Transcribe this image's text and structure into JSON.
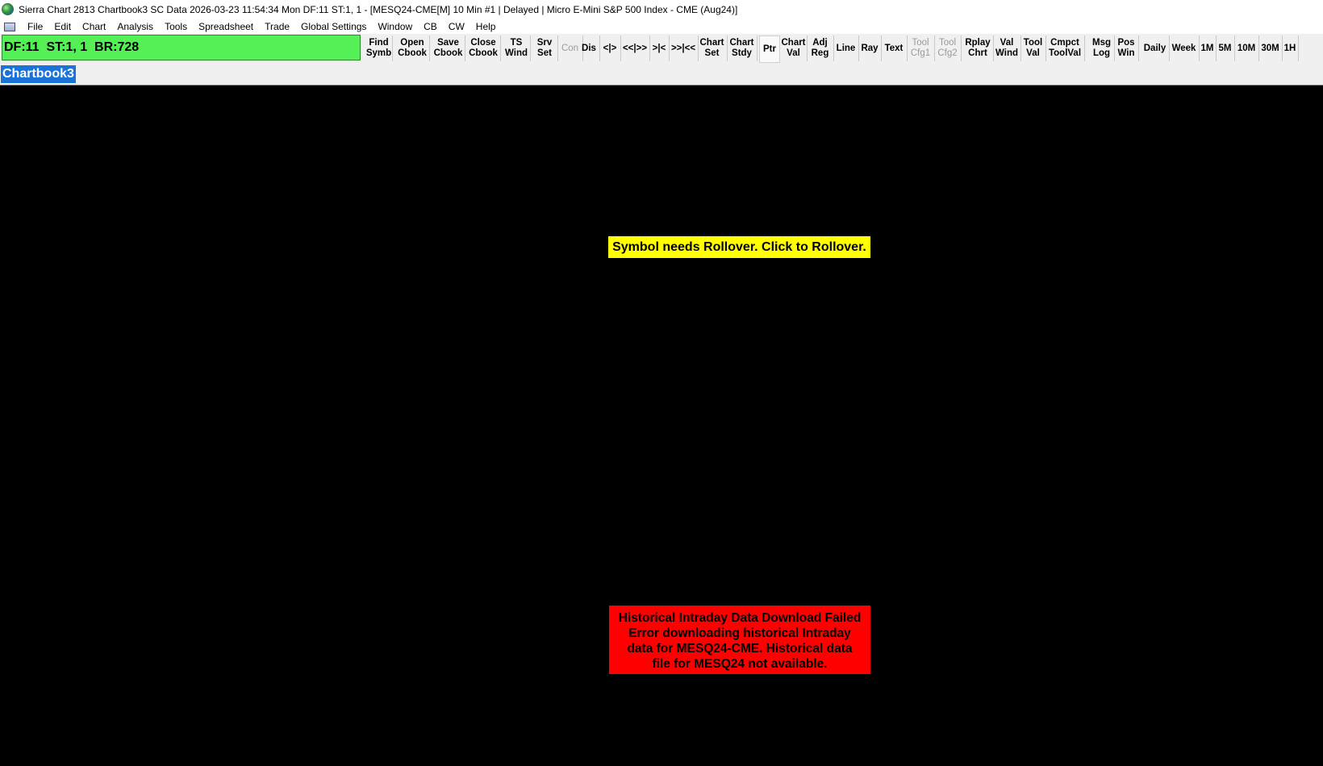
{
  "titlebar": {
    "icon": "sierra-chart-globe-icon",
    "text": "Sierra Chart 2813 Chartbook3 SC Data 2026-03-23  11:54:34 Mon DF:11  ST:1, 1 - [MESQ24-CME[M]  10 Min  #1 | Delayed | Micro E-Mini S&P 500 Index - CME (Aug24)]"
  },
  "menubar": {
    "icon": "chartbook-menu-icon",
    "items": [
      "File",
      "Edit",
      "Chart",
      "Analysis",
      "Tools",
      "Spreadsheet",
      "Trade",
      "Global Settings",
      "Window",
      "CB",
      "CW",
      "Help"
    ]
  },
  "status": {
    "text": "DF:11  ST:1, 1  BR:728",
    "color": "#55f055"
  },
  "toolbar": {
    "buttons": [
      {
        "label": "Find\nSymb"
      },
      {
        "label": "Open\nCbook"
      },
      {
        "label": "Save\nCbook"
      },
      {
        "label": "Close\nCbook"
      },
      {
        "label": "TS\nWind"
      },
      {
        "label": "Srv\nSet"
      },
      {
        "label": "Con",
        "disabled": true
      },
      {
        "label": "Dis"
      },
      {
        "label": "<|>"
      },
      {
        "label": "<<|>>"
      },
      {
        "label": ">|<"
      },
      {
        "label": ">>|<<"
      },
      {
        "label": "Chart\nSet"
      },
      {
        "label": "Chart\nStdy"
      },
      {
        "label": "Ptr",
        "pressed": true
      },
      {
        "label": "Chart\nVal"
      },
      {
        "label": "Adj\nReg"
      },
      {
        "label": "Line"
      },
      {
        "label": "Ray"
      },
      {
        "label": "Text"
      },
      {
        "label": "Tool\nCfg1",
        "disabled": true
      },
      {
        "label": "Tool\nCfg2",
        "disabled": true
      },
      {
        "label": "Rplay\nChrt"
      },
      {
        "label": "Val\nWind"
      },
      {
        "label": "Tool\nVal"
      },
      {
        "label": "Cmpct\nToolVal"
      },
      {
        "label": "Msg\nLog"
      },
      {
        "label": "Pos\nWin"
      },
      {
        "label": "Daily"
      },
      {
        "label": "Week"
      },
      {
        "label": "1M"
      },
      {
        "label": "5M"
      },
      {
        "label": "10M"
      },
      {
        "label": "30M"
      },
      {
        "label": "1H"
      }
    ]
  },
  "tabs": [
    {
      "label": "Chartbook3",
      "active": true,
      "color": "#1a73d9"
    }
  ],
  "chart": {
    "background": "#000000",
    "rollover_message": "Symbol needs Rollover. Click to Rollover.",
    "rollover_color": "#ffff00",
    "error_lines": [
      "Historical Intraday Data Download Failed",
      "Error downloading historical Intraday",
      "data for MESQ24-CME. Historical data",
      "file for MESQ24 not available."
    ],
    "error_color": "#ff0000"
  }
}
